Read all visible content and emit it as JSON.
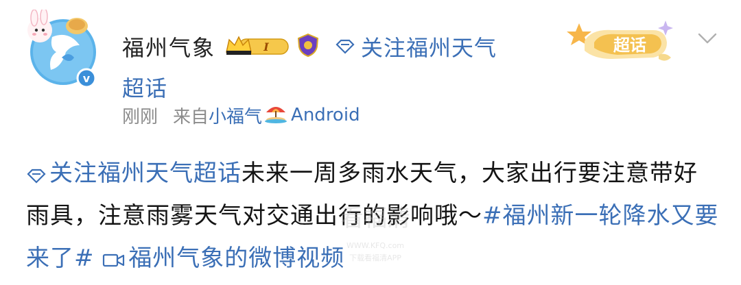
{
  "author": {
    "name": "福州气象",
    "badge_level": "I"
  },
  "topic_chip": {
    "label": "关注福州天气",
    "label_suffix": "超话"
  },
  "meta": {
    "time": "刚刚",
    "source_prefix": "来自",
    "source_name": "小福气",
    "platform": "Android"
  },
  "supertopic_badge": {
    "label": "超话"
  },
  "post": {
    "topic_link": "关注福州天气超话",
    "text": "未来一周多雨水天气，大家出行要注意带好雨具，注意雨雾天气对交通出行的影响哦～",
    "hashtag": "#福州新一轮降水又要来了#",
    "video_link": "福州气象的微博视频"
  },
  "watermark": {
    "title": "看福清",
    "line1": "WWW.KFQ.com",
    "line2": "下载看福清APP"
  },
  "colors": {
    "link": "#3b6fb6",
    "meta_gray": "#8b8b8b",
    "text": "#141414"
  },
  "icons": [
    "avatar-bunny",
    "crown-icon",
    "shield-icon",
    "diamond-topic-icon",
    "beach-umbrella-icon",
    "chevron-down-icon",
    "video-icon",
    "star-icon"
  ]
}
